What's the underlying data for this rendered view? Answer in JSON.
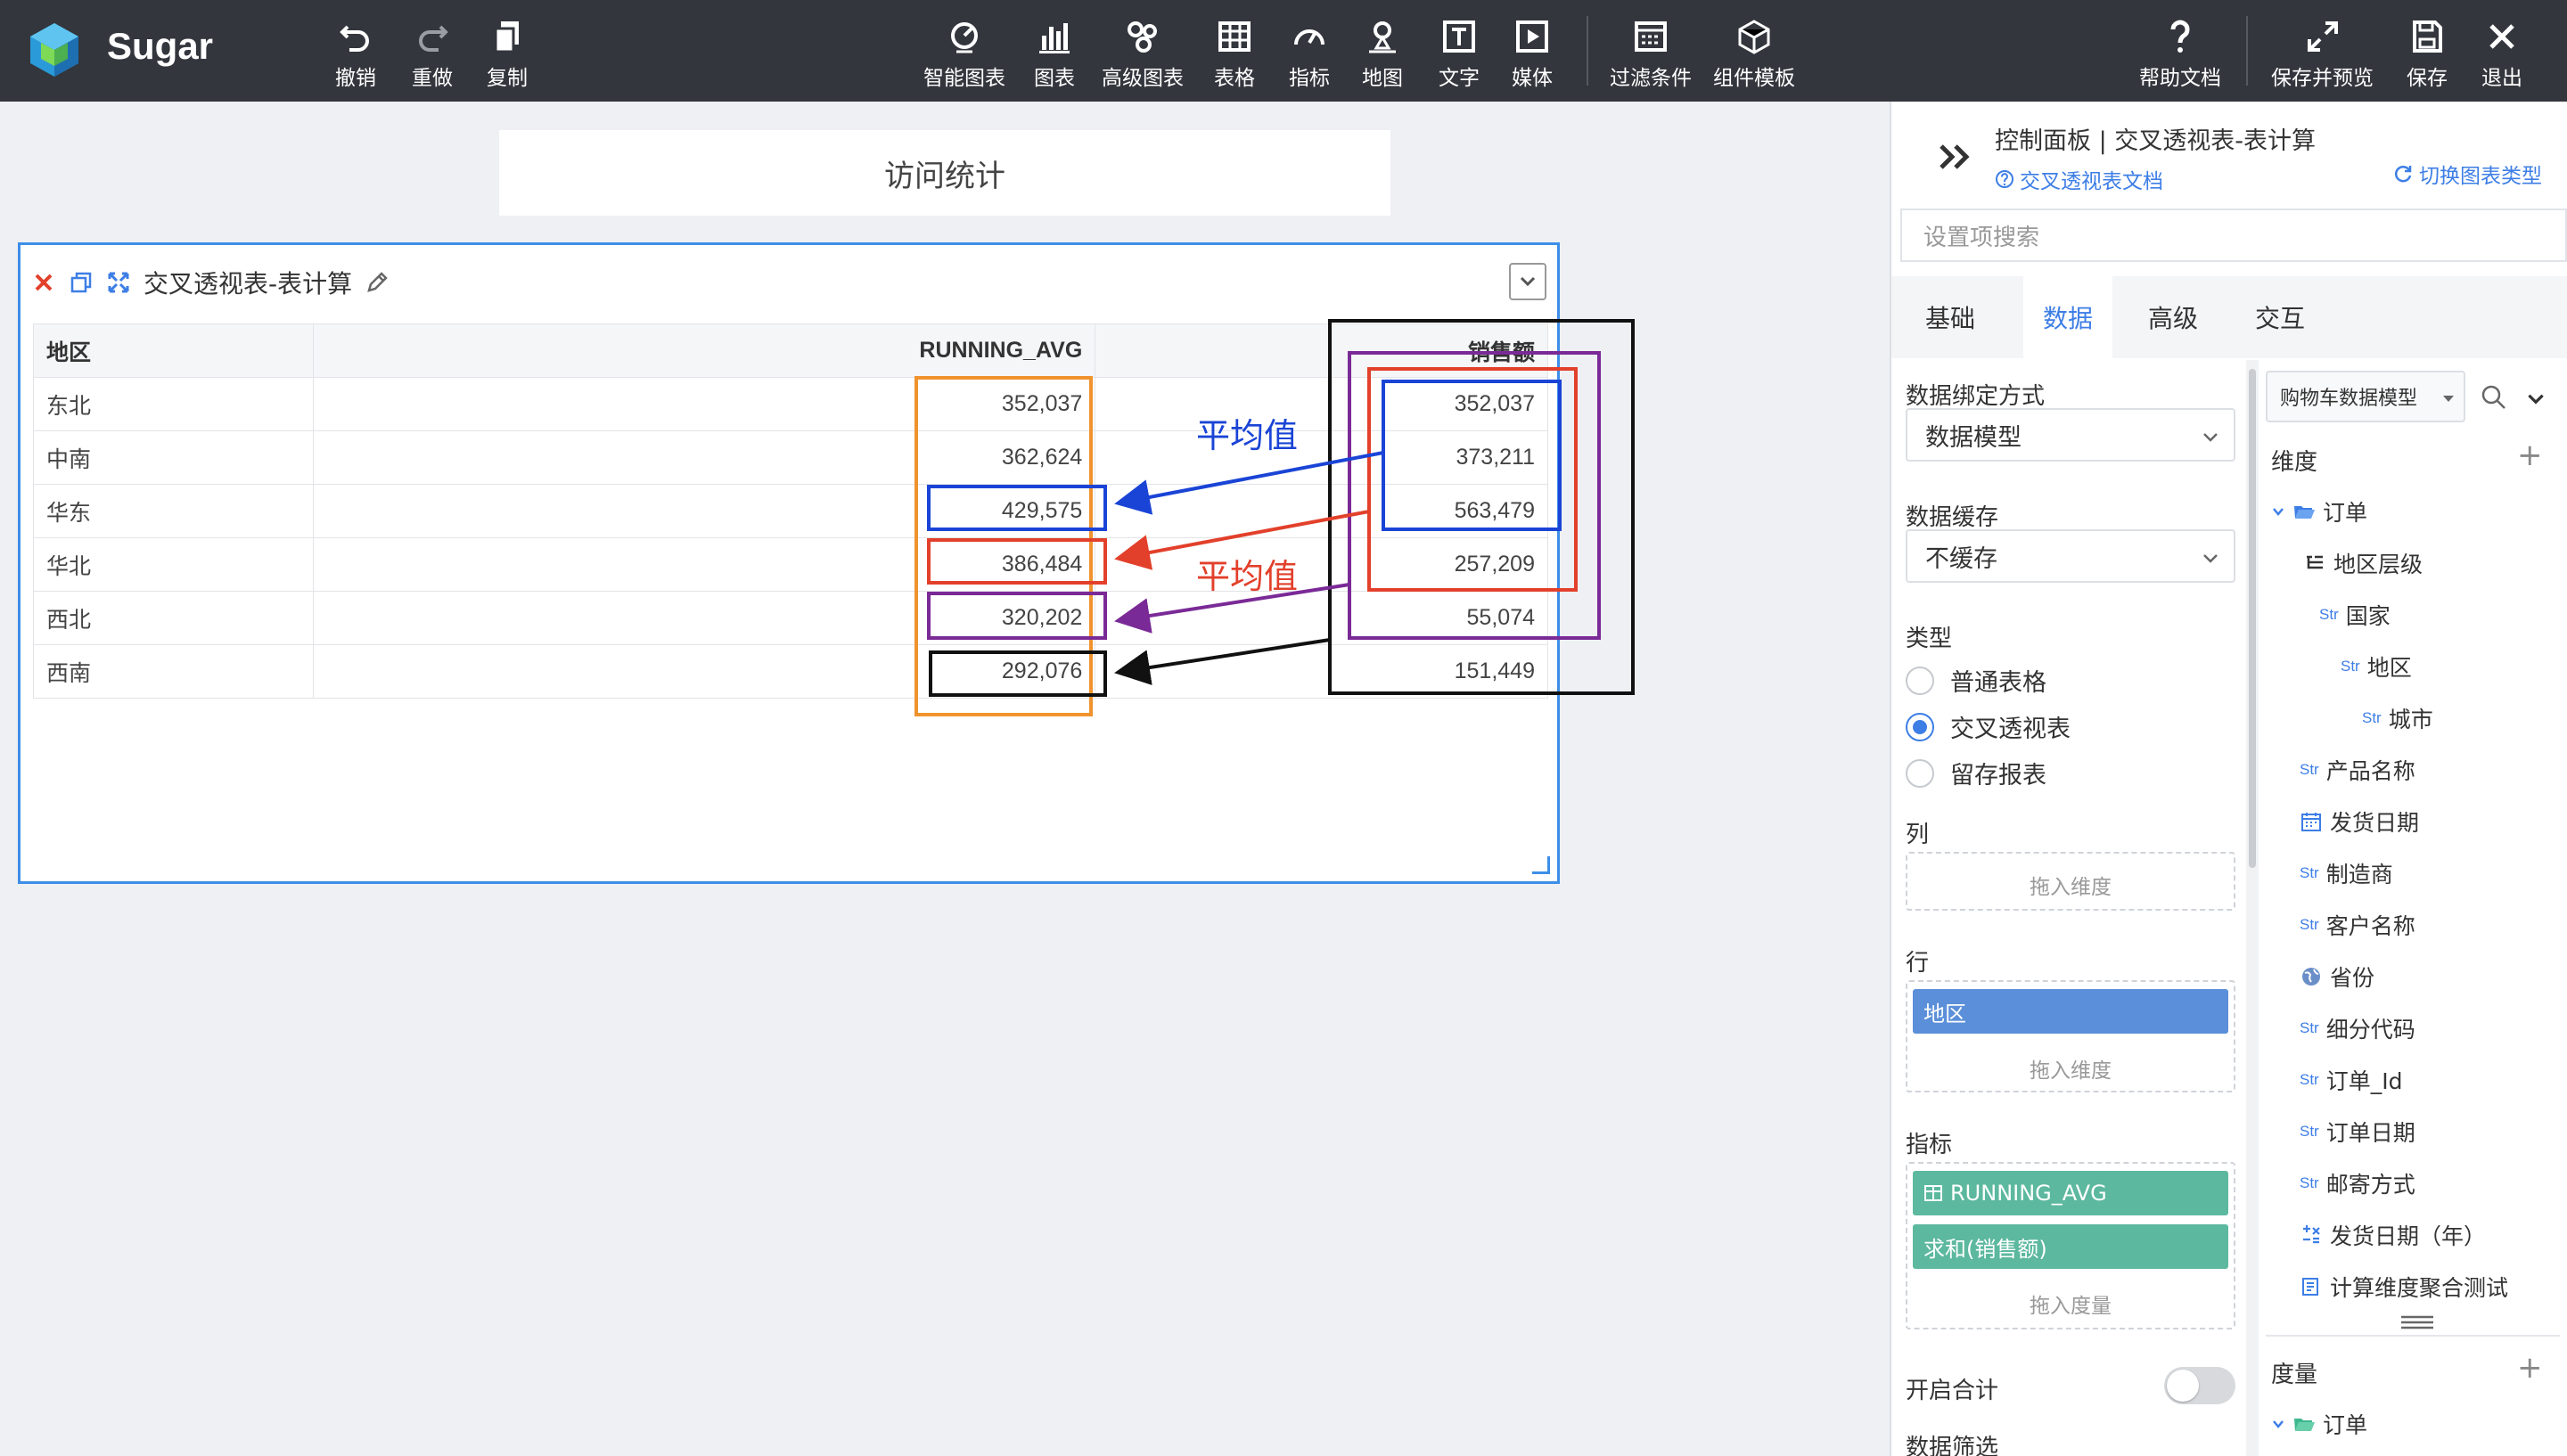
{
  "app": {
    "name": "Sugar"
  },
  "toolbar": {
    "undo": "撤销",
    "redo": "重做",
    "copy": "复制",
    "smart_chart": "智能图表",
    "chart": "图表",
    "adv_chart": "高级图表",
    "table": "表格",
    "indicator": "指标",
    "map": "地图",
    "text": "文字",
    "media": "媒体",
    "filter": "过滤条件",
    "template": "组件模板",
    "help": "帮助文档",
    "save_preview": "保存并预览",
    "save": "保存",
    "exit": "退出"
  },
  "dashboard": {
    "title": "访问统计"
  },
  "widget": {
    "title": "交叉透视表-表计算",
    "columns": [
      "地区",
      "RUNNING_AVG",
      "销售额"
    ],
    "rows": [
      {
        "region": "东北",
        "running_avg": "352,037",
        "sales": "352,037"
      },
      {
        "region": "中南",
        "running_avg": "362,624",
        "sales": "373,211"
      },
      {
        "region": "华东",
        "running_avg": "429,575",
        "sales": "563,479"
      },
      {
        "region": "华北",
        "running_avg": "386,484",
        "sales": "257,209"
      },
      {
        "region": "西北",
        "running_avg": "320,202",
        "sales": "55,074"
      },
      {
        "region": "西南",
        "running_avg": "292,076",
        "sales": "151,449"
      }
    ]
  },
  "annotations": {
    "label_top": "平均值",
    "label_bottom": "平均值",
    "colors": {
      "orange": "#f0932e",
      "blue": "#1a44d6",
      "red": "#e2402b",
      "purple": "#7a2a96",
      "black": "#111111"
    }
  },
  "panel": {
    "title": "控制面板 | 交叉透视表-表计算",
    "doc_link": "交叉透视表文档",
    "switch_type": "切换图表类型",
    "search_placeholder": "设置项搜索",
    "tabs": [
      "基础",
      "数据",
      "高级",
      "交互"
    ],
    "active_tab": "数据",
    "binding_label": "数据绑定方式",
    "binding_value": "数据模型",
    "cache_label": "数据缓存",
    "cache_value": "不缓存",
    "type_label": "类型",
    "types": [
      "普通表格",
      "交叉透视表",
      "留存报表"
    ],
    "selected_type": "交叉透视表",
    "col_label": "列",
    "drag_dimension": "拖入维度",
    "row_label": "行",
    "row_chip": "地区",
    "measure_label": "指标",
    "measure_chips": [
      "RUNNING_AVG",
      "求和(销售额)"
    ],
    "drag_measure": "拖入度量",
    "total_label": "开启合计",
    "data_filter_label": "数据筛选",
    "model_select": "购物车数据模型",
    "dimension_title": "维度",
    "measure_title": "度量",
    "str_tag": "Str",
    "tree": [
      "订单",
      "地区层级",
      "国家",
      "地区",
      "城市",
      "产品名称",
      "发货日期",
      "制造商",
      "客户名称",
      "省份",
      "细分代码",
      "订单_Id",
      "订单日期",
      "邮寄方式",
      "发货日期（年）",
      "计算维度聚合测试"
    ],
    "measure_tree": [
      "订单"
    ]
  }
}
